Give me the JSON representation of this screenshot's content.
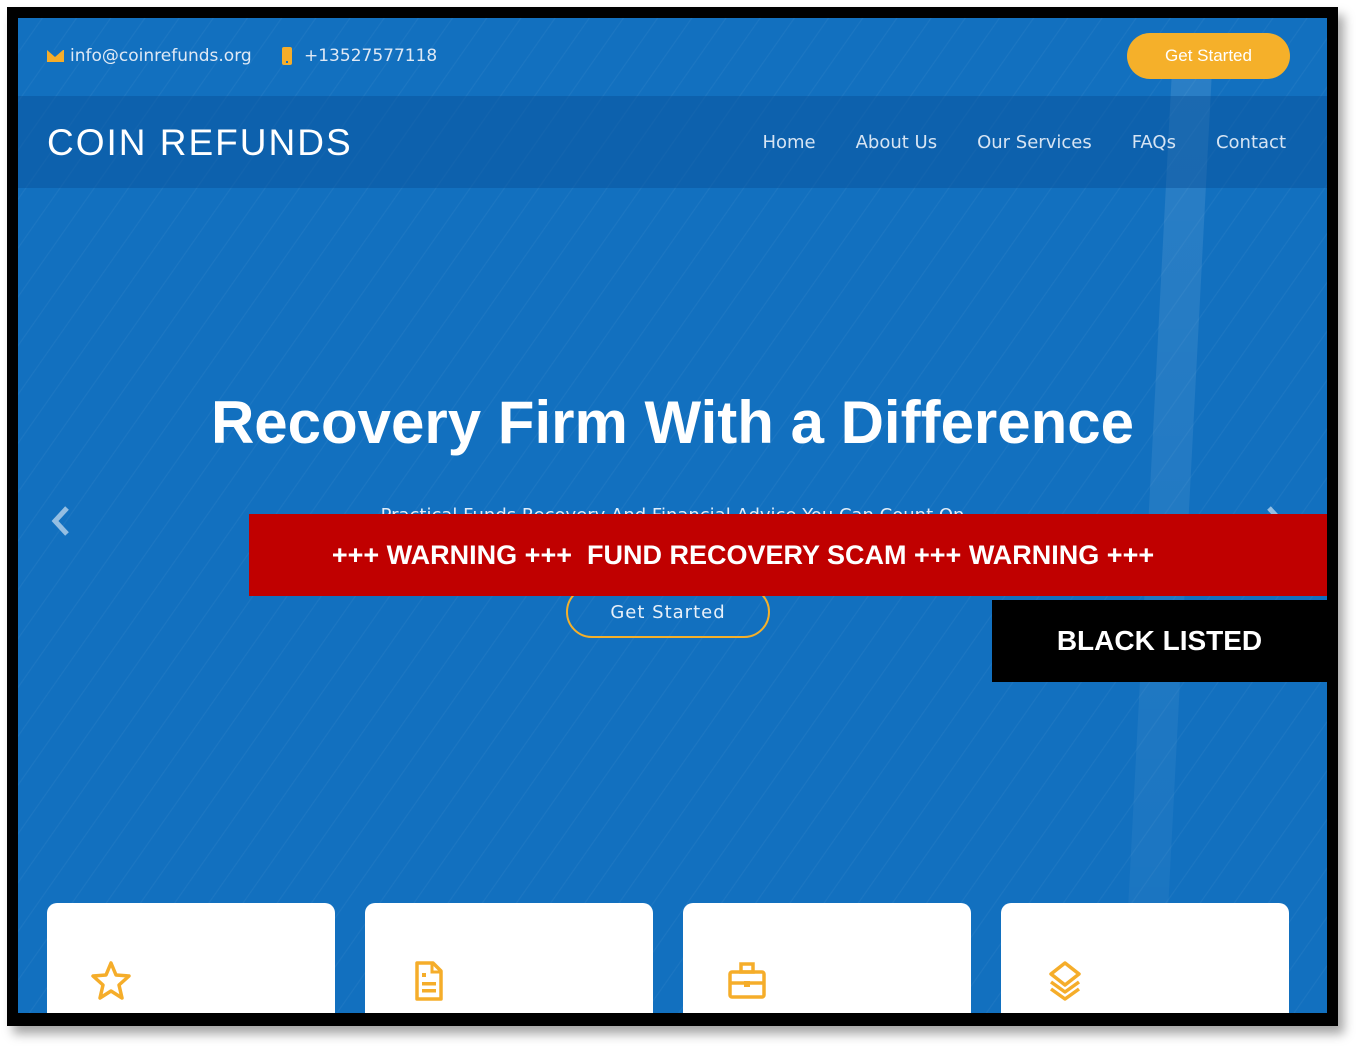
{
  "topbar": {
    "email": "info@coinrefunds.org",
    "phone": "+13527577118",
    "cta_label": "Get Started"
  },
  "navbar": {
    "logo": "COIN REFUNDS",
    "items": [
      {
        "label": "Home"
      },
      {
        "label": "About Us"
      },
      {
        "label": "Our Services"
      },
      {
        "label": "FAQs"
      },
      {
        "label": "Contact"
      }
    ]
  },
  "hero": {
    "title": "Recovery Firm With a Difference",
    "subtitle": "Practical Funds Recovery And Financial Advice You Can Count On",
    "cta_label": "Get Started",
    "prev_icon": "chevron-left-icon",
    "next_icon": "chevron-right-icon"
  },
  "overlay": {
    "warning": "+++ WARNING +++  FUND RECOVERY SCAM +++ WARNING +++",
    "blacklisted": "BLACK LISTED",
    "warning_color": "#c00000",
    "blacklisted_color": "#000000"
  },
  "cards": [
    {
      "icon": "star-icon"
    },
    {
      "icon": "document-icon"
    },
    {
      "icon": "briefcase-icon"
    },
    {
      "icon": "layers-icon"
    }
  ],
  "colors": {
    "brand_blue": "#1270bf",
    "accent": "#f5b02a"
  }
}
